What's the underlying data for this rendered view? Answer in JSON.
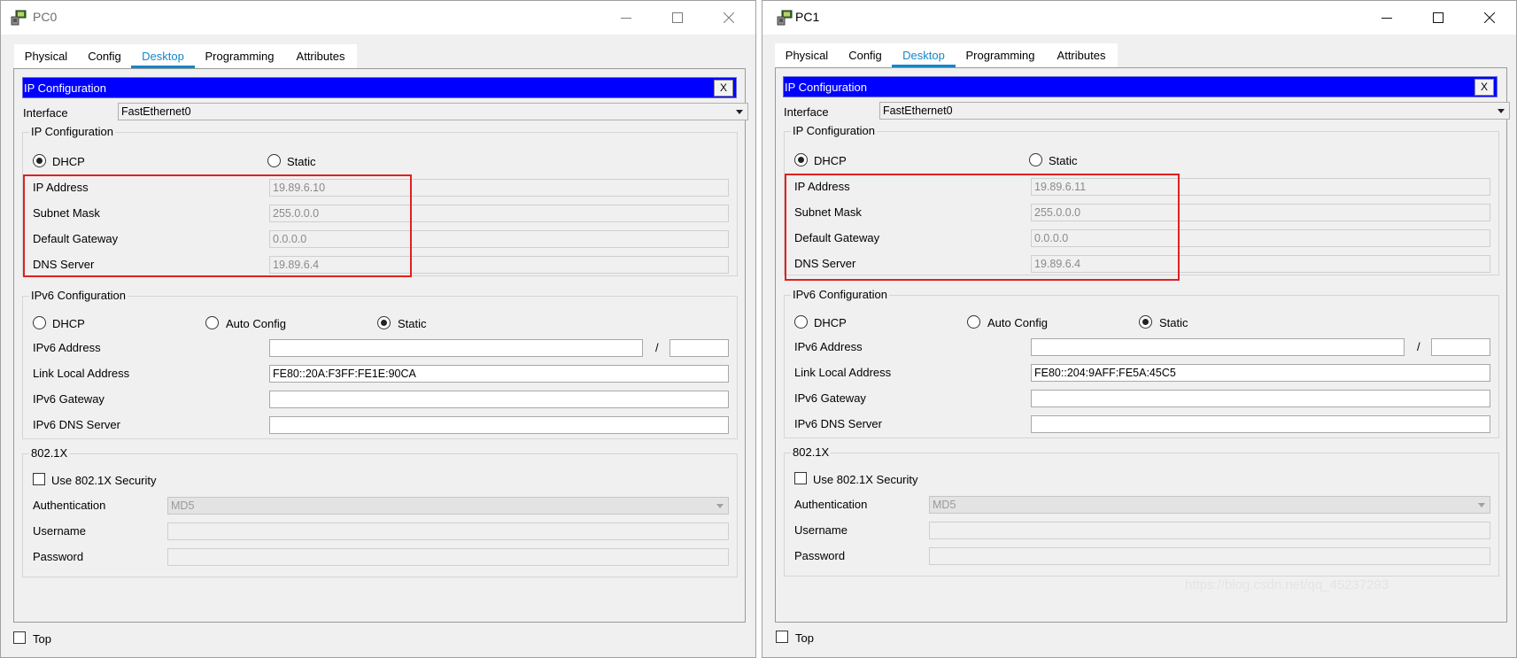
{
  "tabs": [
    "Physical",
    "Config",
    "Desktop",
    "Programming",
    "Attributes"
  ],
  "panel_title": "IP Configuration",
  "close_label": "X",
  "interface_label": "Interface",
  "interface_value": "FastEthernet0",
  "ipv4": {
    "group_title": "IP Configuration",
    "dhcp": "DHCP",
    "static": "Static",
    "ip_label": "IP Address",
    "mask_label": "Subnet Mask",
    "gateway_label": "Default Gateway",
    "dns_label": "DNS Server"
  },
  "ipv6": {
    "group_title": "IPv6 Configuration",
    "dhcp": "DHCP",
    "auto": "Auto Config",
    "static": "Static",
    "address_label": "IPv6 Address",
    "slash": "/",
    "link_local_label": "Link Local Address",
    "gateway_label": "IPv6 Gateway",
    "dns_label": "IPv6 DNS Server"
  },
  "dot1x": {
    "group_title": "802.1X",
    "use_label": "Use 802.1X Security",
    "auth_label": "Authentication",
    "auth_value": "MD5",
    "username_label": "Username",
    "password_label": "Password"
  },
  "top_label": "Top",
  "colors": {
    "header_blue": "#0000ff",
    "tab_accent": "#1586c9",
    "highlight_red": "#e02020"
  },
  "pcs": [
    {
      "title": "PC0",
      "ip": "19.89.6.10",
      "mask": "255.0.0.0",
      "gateway": "0.0.0.0",
      "dns": "19.89.6.4",
      "link_local": "FE80::20A:F3FF:FE1E:90CA"
    },
    {
      "title": "PC1",
      "ip": "19.89.6.11",
      "mask": "255.0.0.0",
      "gateway": "0.0.0.0",
      "dns": "19.89.6.4",
      "link_local": "FE80::204:9AFF:FE5A:45C5"
    }
  ],
  "watermark": "https://blog.csdn.net/qq_45237293"
}
